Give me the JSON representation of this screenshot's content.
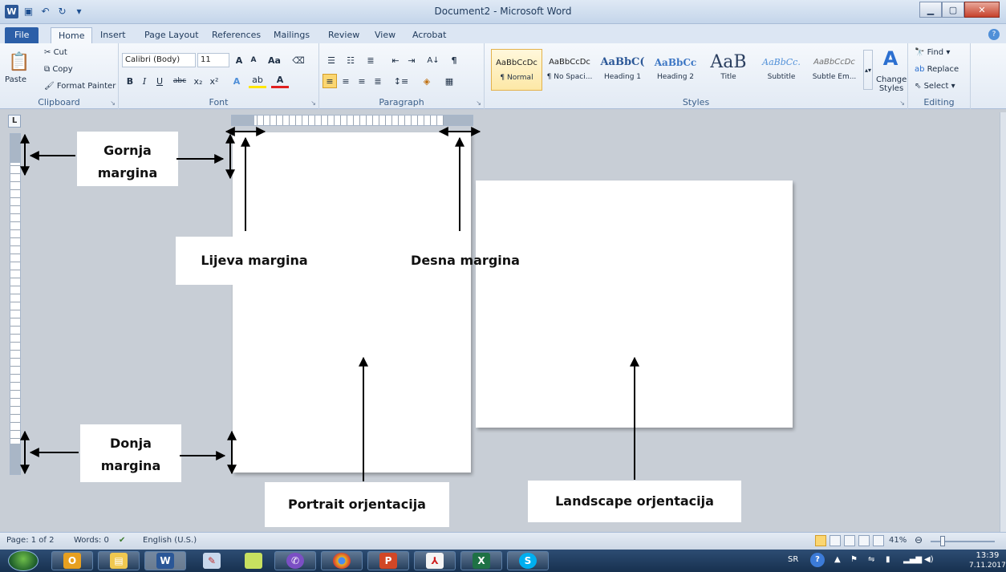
{
  "titlebar": {
    "title": "Document2 - Microsoft Word",
    "qat_icons": [
      "word-app-icon",
      "save-icon",
      "undo-icon",
      "redo-icon",
      "customize-qat-icon"
    ]
  },
  "tabs": [
    {
      "label": "File"
    },
    {
      "label": "Home"
    },
    {
      "label": "Insert"
    },
    {
      "label": "Page Layout"
    },
    {
      "label": "References"
    },
    {
      "label": "Mailings"
    },
    {
      "label": "Review"
    },
    {
      "label": "View"
    },
    {
      "label": "Acrobat"
    }
  ],
  "ribbon": {
    "clipboard": {
      "label": "Clipboard",
      "paste": "Paste",
      "cut": "Cut",
      "copy": "Copy",
      "format_painter": "Format Painter"
    },
    "font": {
      "label": "Font",
      "font_name": "Calibri (Body)",
      "font_size": "11",
      "bold": "B",
      "italic": "I",
      "underline": "U",
      "strike": "abc",
      "sub": "x₂",
      "sup": "x²",
      "grow": "A",
      "shrink": "A",
      "case": "Aa"
    },
    "paragraph": {
      "label": "Paragraph",
      "pilcrow": "¶",
      "sort": "A↓"
    },
    "styles": {
      "label": "Styles",
      "items": [
        {
          "sample": "AaBbCcDc",
          "name": "¶ Normal"
        },
        {
          "sample": "AaBbCcDc",
          "name": "¶ No Spaci..."
        },
        {
          "sample": "AaBbC(",
          "name": "Heading 1"
        },
        {
          "sample": "AaBbCc",
          "name": "Heading 2"
        },
        {
          "sample": "AaB",
          "name": "Title"
        },
        {
          "sample": "AaBbCc.",
          "name": "Subtitle"
        },
        {
          "sample": "AaBbCcDc",
          "name": "Subtle Em..."
        }
      ],
      "change_styles": "Change Styles"
    },
    "editing": {
      "label": "Editing",
      "find": "Find",
      "replace": "Replace",
      "select": "Select"
    }
  },
  "annotations": {
    "gornja": "Gornja margina",
    "donja": "Donja margina",
    "lijeva": "Lijeva margina",
    "desna": "Desna margina",
    "portrait": "Portrait orjentacija",
    "landscape": "Landscape orjentacija"
  },
  "ruler": {
    "corner": "L"
  },
  "statusbar": {
    "page": "Page: 1 of 2",
    "words": "Words: 0",
    "language": "English (U.S.)",
    "zoom": "41%"
  },
  "taskbar": {
    "apps": [
      "Outlook",
      "Explorer",
      "Word",
      "Paint",
      "Sticky Notes",
      "Viber",
      "Chrome",
      "PowerPoint",
      "Acrobat",
      "Excel",
      "Skype"
    ],
    "lang": "SR",
    "time": "13:39",
    "date": "7.11.2017"
  }
}
